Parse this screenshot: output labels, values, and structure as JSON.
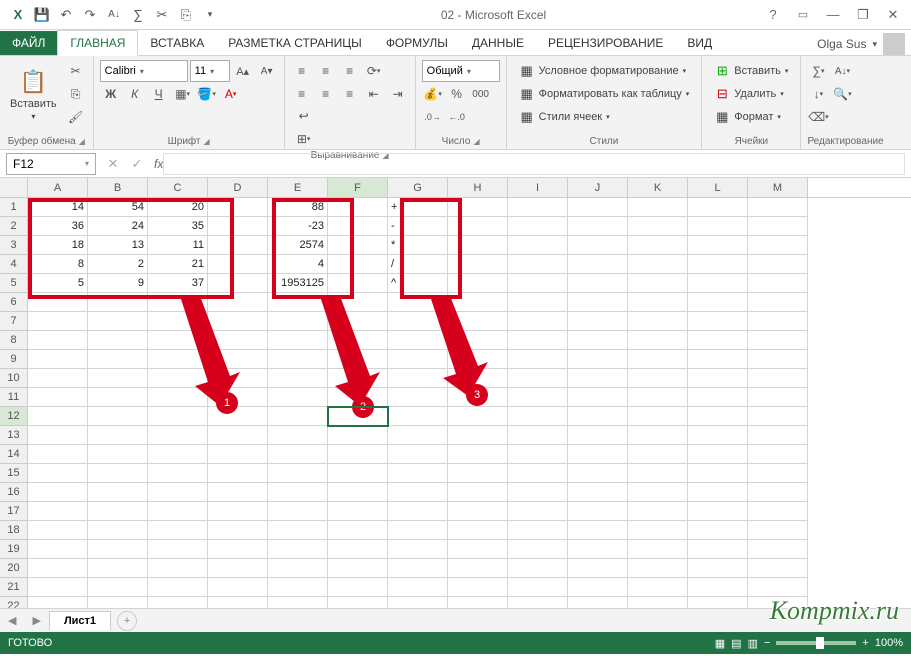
{
  "title": "02 - Microsoft Excel",
  "user": "Olga Sus",
  "tabs": {
    "file": "ФАЙЛ",
    "home": "ГЛАВНАЯ",
    "insert": "ВСТАВКА",
    "page_layout": "РАЗМЕТКА СТРАНИЦЫ",
    "formulas": "ФОРМУЛЫ",
    "data": "ДАННЫЕ",
    "review": "РЕЦЕНЗИРОВАНИЕ",
    "view": "ВИД"
  },
  "ribbon": {
    "clipboard": {
      "paste": "Вставить",
      "label": "Буфер обмена"
    },
    "font": {
      "name": "Calibri",
      "size": "11",
      "label": "Шрифт",
      "bold": "Ж",
      "italic": "К",
      "underline": "Ч"
    },
    "alignment": {
      "label": "Выравнивание"
    },
    "number": {
      "format": "Общий",
      "label": "Число"
    },
    "styles": {
      "conditional": "Условное форматирование",
      "as_table": "Форматировать как таблицу",
      "cell_styles": "Стили ячеек",
      "label": "Стили"
    },
    "cells": {
      "insert": "Вставить",
      "delete": "Удалить",
      "format": "Формат",
      "label": "Ячейки"
    },
    "editing": {
      "label": "Редактирование"
    }
  },
  "namebox": "F12",
  "columns": [
    "A",
    "B",
    "C",
    "D",
    "E",
    "F",
    "G",
    "H",
    "I",
    "J",
    "K",
    "L",
    "M"
  ],
  "rows": 22,
  "active_cell": {
    "row": 12,
    "col": "F"
  },
  "selected_col": "F",
  "selected_row": 12,
  "data": {
    "1": {
      "A": "14",
      "B": "54",
      "C": "20",
      "E": "88",
      "G": "+"
    },
    "2": {
      "A": "36",
      "B": "24",
      "C": "35",
      "E": "-23",
      "G": "-"
    },
    "3": {
      "A": "18",
      "B": "13",
      "C": "11",
      "E": "2574",
      "G": "*"
    },
    "4": {
      "A": "8",
      "B": "2",
      "C": "21",
      "E": "4",
      "G": "/"
    },
    "5": {
      "A": "5",
      "B": "9",
      "C": "37",
      "E": "1953125",
      "G": "^"
    }
  },
  "annotations": {
    "1": "1",
    "2": "2",
    "3": "3"
  },
  "sheet": "Лист1",
  "status": "ГОТОВО",
  "zoom": "100%",
  "watermark": "Kompmix.ru"
}
